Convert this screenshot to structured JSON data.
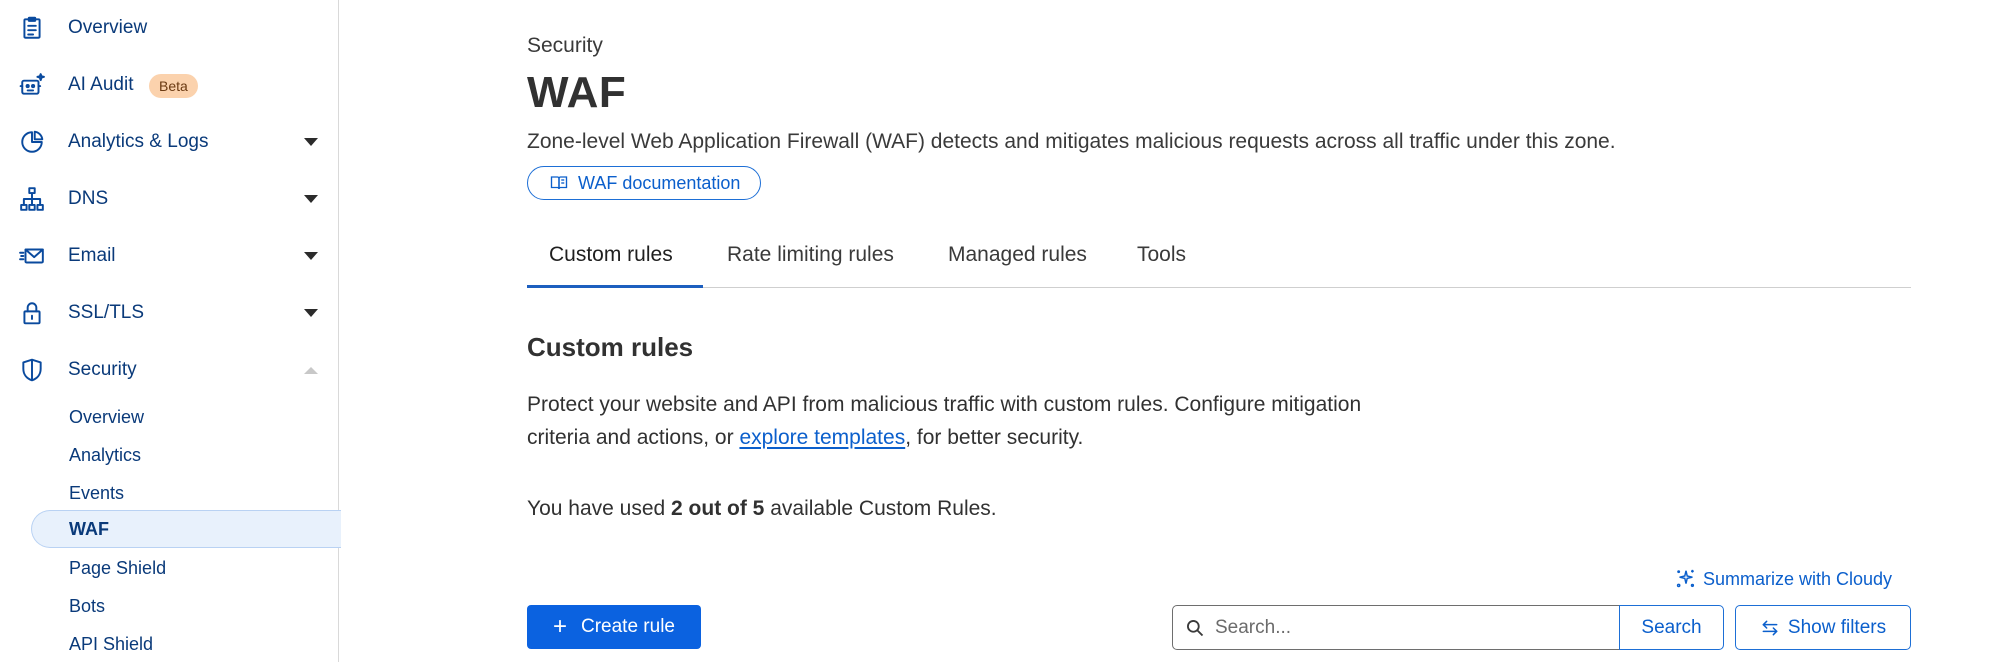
{
  "sidebar": {
    "items": [
      {
        "label": "Overview",
        "icon": "clipboard-icon"
      },
      {
        "label": "AI Audit",
        "icon": "robot-icon",
        "badge": "Beta"
      },
      {
        "label": "Analytics & Logs",
        "icon": "pie-chart-icon"
      },
      {
        "label": "DNS",
        "icon": "network-icon"
      },
      {
        "label": "Email",
        "icon": "envelope-icon"
      },
      {
        "label": "SSL/TLS",
        "icon": "lock-icon"
      },
      {
        "label": "Security",
        "icon": "shield-icon"
      }
    ],
    "security_sub": [
      "Overview",
      "Analytics",
      "Events",
      "WAF",
      "Page Shield",
      "Bots",
      "API Shield"
    ],
    "active_sub": "WAF"
  },
  "header": {
    "breadcrumb": "Security",
    "title": "WAF",
    "description": "Zone-level Web Application Firewall (WAF) detects and mitigates malicious requests across all traffic under this zone.",
    "doc_link": "WAF documentation"
  },
  "tabs": [
    {
      "label": "Custom rules",
      "active": true
    },
    {
      "label": "Rate limiting rules"
    },
    {
      "label": "Managed rules"
    },
    {
      "label": "Tools"
    }
  ],
  "custom_rules": {
    "title": "Custom rules",
    "para_before": "Protect your website and API from malicious traffic with custom rules. Configure mitigation criteria and actions, or ",
    "link": "explore templates",
    "para_after": ", for better security.",
    "usage_prefix": "You have used ",
    "usage_count": "2 out of 5",
    "usage_suffix": " available Custom Rules.",
    "summarize": "Summarize with Cloudy",
    "create": "Create rule",
    "search_placeholder": "Search...",
    "search_button": "Search",
    "filters_button": "Show filters"
  },
  "colors": {
    "accent": "#0b62e0",
    "nav_text": "#0a3a7a",
    "badge_bg": "#fbd2ad"
  }
}
